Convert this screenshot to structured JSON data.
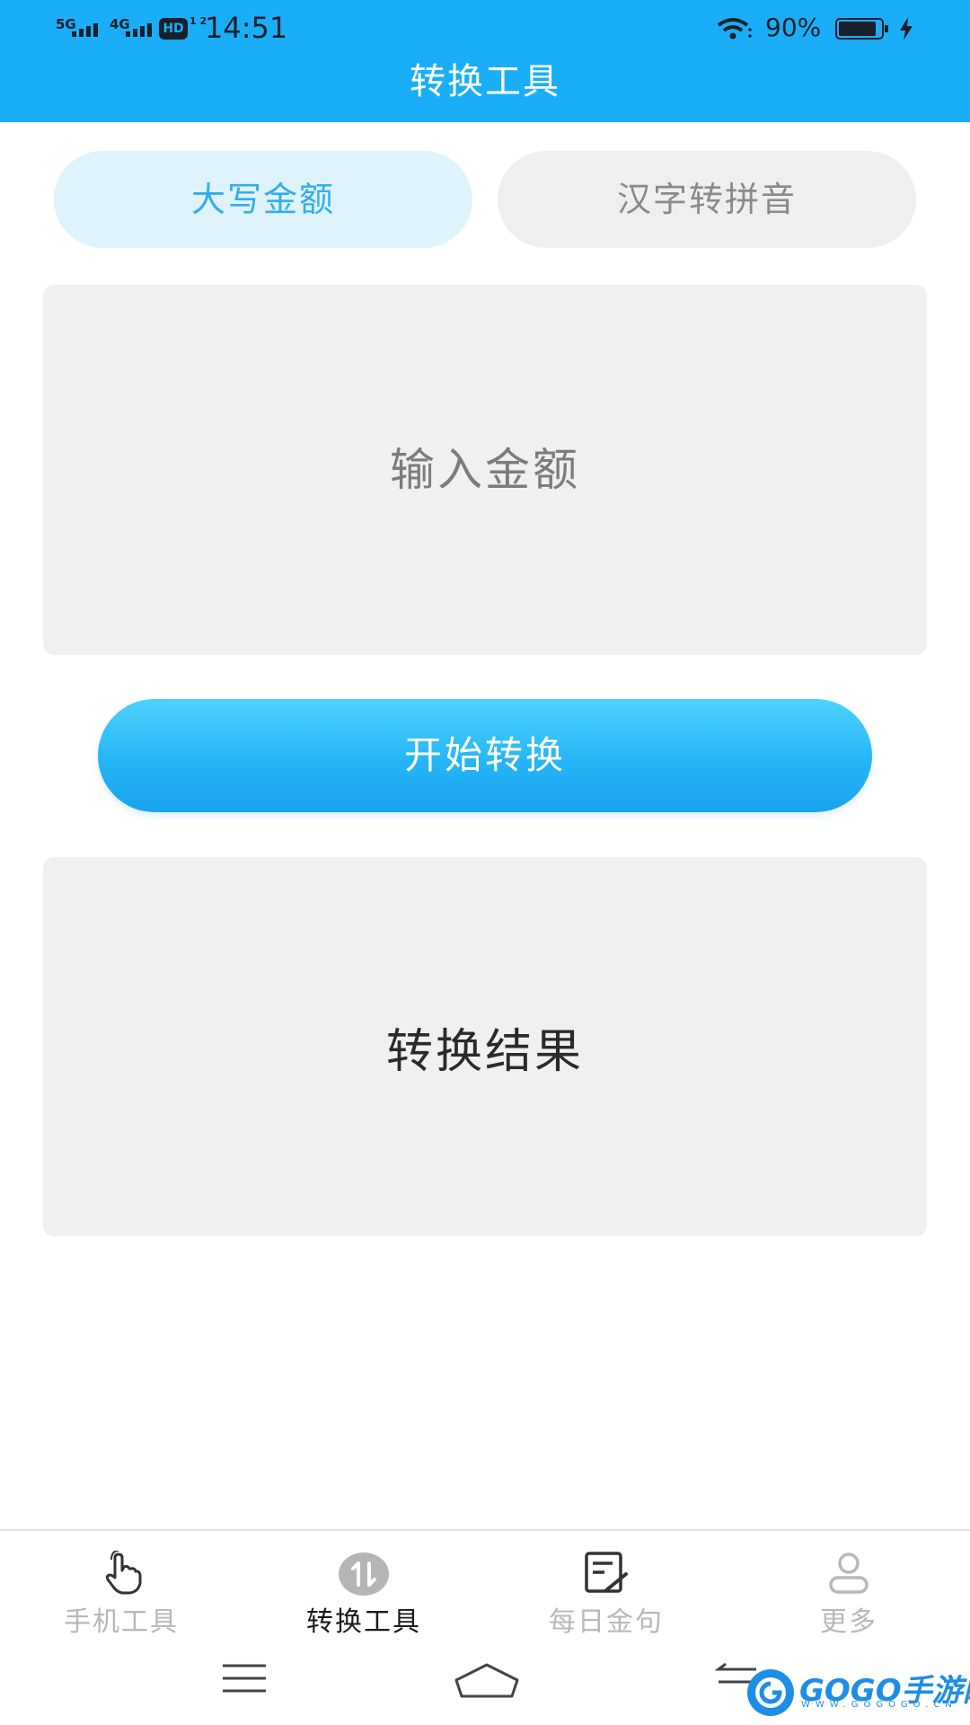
{
  "status_bar": {
    "network1": "5G",
    "network2": "4G",
    "hd": "HD",
    "hd_sub": "1 2",
    "time": "14:51",
    "battery_percent": "90%",
    "battery_level": 0.9,
    "icons": [
      "signal-icon",
      "wifi-icon",
      "battery-icon",
      "charging-icon"
    ]
  },
  "header": {
    "title": "转换工具"
  },
  "tabs": [
    {
      "label": "大写金额",
      "active": true
    },
    {
      "label": "汉字转拼音",
      "active": false
    }
  ],
  "input": {
    "placeholder": "输入金额",
    "value": ""
  },
  "convert_button": {
    "label": "开始转换"
  },
  "result": {
    "text": "转换结果"
  },
  "bottom_nav": [
    {
      "label": "手机工具",
      "icon": "hand-pointer-icon",
      "active": false
    },
    {
      "label": "转换工具",
      "icon": "swap-arrows-icon",
      "active": true
    },
    {
      "label": "每日金句",
      "icon": "note-edit-icon",
      "active": false
    },
    {
      "label": "更多",
      "icon": "person-icon",
      "active": false
    }
  ],
  "system_nav": [
    "menu-icon",
    "home-icon",
    "back-icon"
  ],
  "watermark": {
    "text": "GOGO手游网",
    "sub": "WWW.GOGOGO.CN"
  },
  "colors": {
    "accent": "#1aaef8",
    "tab_active_bg": "#dff3fd",
    "tab_active_text": "#33aee8",
    "panel_bg": "#f0f0f0"
  }
}
